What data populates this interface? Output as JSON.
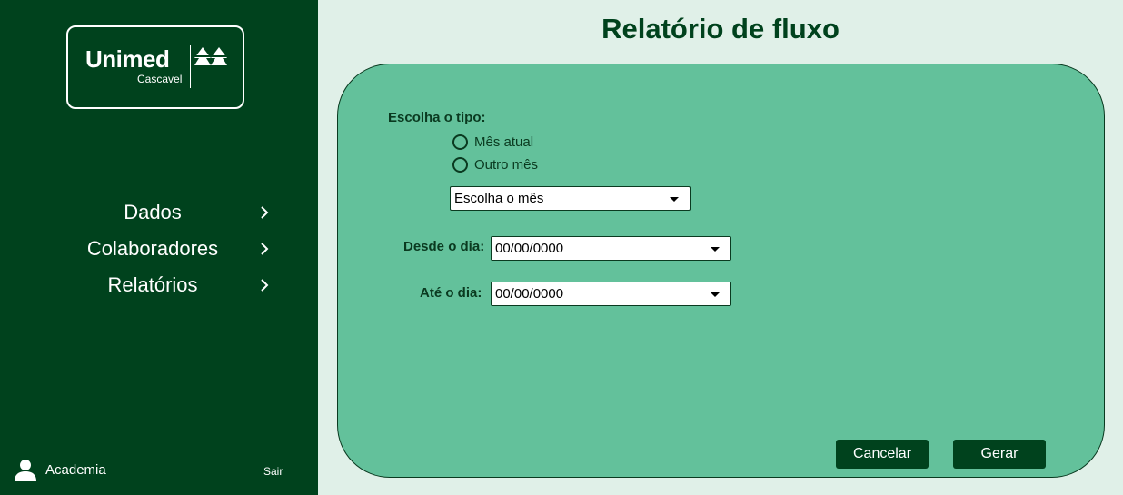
{
  "sidebar": {
    "logo": {
      "name": "Unimed",
      "city": "Cascavel"
    },
    "items": [
      {
        "label": "Dados"
      },
      {
        "label": "Colaboradores"
      },
      {
        "label": "Relatórios"
      }
    ],
    "user": {
      "name": "Academia"
    },
    "logout_label": "Sair"
  },
  "main": {
    "title": "Relatório de fluxo",
    "type_label": "Escolha o tipo:",
    "options": [
      {
        "label": "Mês atual",
        "checked": false
      },
      {
        "label": "Outro mês",
        "checked": false
      }
    ],
    "month_select": {
      "value": "Escolha o mês"
    },
    "from": {
      "label": "Desde o dia:",
      "value": "00/00/0000"
    },
    "to": {
      "label": "Até o dia:",
      "value": "00/00/0000"
    },
    "cancel_label": "Cancelar",
    "generate_label": "Gerar"
  },
  "colors": {
    "sidebar_bg": "#00421d",
    "page_bg": "#e0f0e8",
    "panel_bg": "#63c19b",
    "button_bg": "#00421d"
  }
}
